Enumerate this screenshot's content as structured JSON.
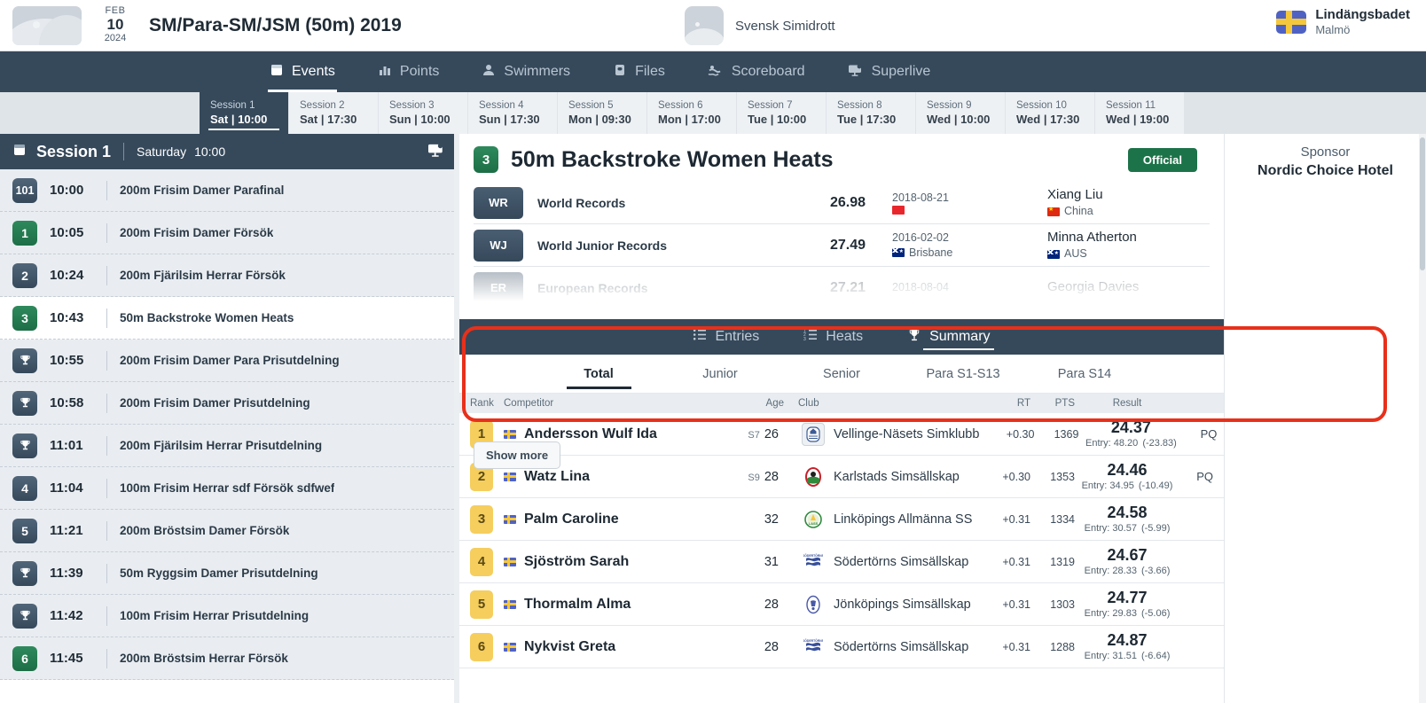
{
  "header": {
    "date": {
      "month": "FEB",
      "day": "10",
      "year": "2024"
    },
    "meet_title": "SM/Para-SM/JSM (50m) 2019",
    "organizer": "Svensk Simidrott",
    "venue_name": "Lindängsbadet",
    "venue_city": "Malmö",
    "meet_logo_icon": "image-placeholder-icon",
    "org_logo_icon": "image-placeholder-icon",
    "flag_icon": "sweden-flag-icon"
  },
  "nav": {
    "items": [
      {
        "label": "Events",
        "icon": "calendar-icon",
        "active": true
      },
      {
        "label": "Points",
        "icon": "bar-chart-icon",
        "active": false
      },
      {
        "label": "Swimmers",
        "icon": "person-icon",
        "active": false
      },
      {
        "label": "Files",
        "icon": "folder-icon",
        "active": false
      },
      {
        "label": "Scoreboard",
        "icon": "swimmer-icon",
        "active": false
      },
      {
        "label": "Superlive",
        "icon": "monitor-broadcast-icon",
        "active": false
      }
    ]
  },
  "sessions": [
    {
      "name": "Session 1",
      "time": "Sat | 10:00",
      "active": true
    },
    {
      "name": "Session 2",
      "time": "Sat | 17:30",
      "active": false
    },
    {
      "name": "Session 3",
      "time": "Sun | 10:00",
      "active": false
    },
    {
      "name": "Session 4",
      "time": "Sun | 17:30",
      "active": false
    },
    {
      "name": "Session 5",
      "time": "Mon | 09:30",
      "active": false
    },
    {
      "name": "Session 6",
      "time": "Mon | 17:00",
      "active": false
    },
    {
      "name": "Session 7",
      "time": "Tue | 10:00",
      "active": false
    },
    {
      "name": "Session 8",
      "time": "Tue | 17:30",
      "active": false
    },
    {
      "name": "Session 9",
      "time": "Wed | 10:00",
      "active": false
    },
    {
      "name": "Session 10",
      "time": "Wed | 17:30",
      "active": false
    },
    {
      "name": "Session 11",
      "time": "Wed | 19:00",
      "active": false
    }
  ],
  "sidebar": {
    "title": "Session 1",
    "day": "Saturday",
    "time": "10:00",
    "header_icon": "calendar-icon",
    "live_icon": "monitor-broadcast-icon",
    "events": [
      {
        "badge": "101",
        "badge_type": "slate",
        "time": "10:00",
        "name": "200m Frisim Damer Parafinal",
        "selected": false
      },
      {
        "badge": "1",
        "badge_type": "green",
        "time": "10:05",
        "name": "200m Frisim Damer Försök",
        "selected": false
      },
      {
        "badge": "2",
        "badge_type": "slate",
        "time": "10:24",
        "name": "200m Fjärilsim Herrar Försök",
        "selected": false
      },
      {
        "badge": "3",
        "badge_type": "green",
        "time": "10:43",
        "name": "50m Backstroke Women Heats",
        "selected": true
      },
      {
        "badge": "",
        "badge_type": "trophy",
        "time": "10:55",
        "name": "200m Frisim Damer Para Prisutdelning",
        "selected": false
      },
      {
        "badge": "",
        "badge_type": "trophy",
        "time": "10:58",
        "name": "200m Frisim Damer Prisutdelning",
        "selected": false
      },
      {
        "badge": "",
        "badge_type": "trophy",
        "time": "11:01",
        "name": "200m Fjärilsim Herrar Prisutdelning",
        "selected": false
      },
      {
        "badge": "4",
        "badge_type": "slate",
        "time": "11:04",
        "name": "100m Frisim Herrar sdf Försök sdfwef",
        "selected": false
      },
      {
        "badge": "5",
        "badge_type": "slate",
        "time": "11:21",
        "name": "200m Bröstsim Damer Försök",
        "selected": false
      },
      {
        "badge": "",
        "badge_type": "trophy",
        "time": "11:39",
        "name": "50m Ryggsim Damer Prisutdelning",
        "selected": false
      },
      {
        "badge": "",
        "badge_type": "trophy",
        "time": "11:42",
        "name": "100m Frisim Herrar Prisutdelning",
        "selected": false
      },
      {
        "badge": "6",
        "badge_type": "green",
        "time": "11:45",
        "name": "200m Bröstsim Herrar Försök",
        "selected": false
      }
    ]
  },
  "event": {
    "badge": "3",
    "title": "50m Backstroke Women Heats",
    "status": "Official"
  },
  "records": {
    "show_more_label": "Show more",
    "rows": [
      {
        "tag": "WR",
        "name": "World Records",
        "time": "26.98",
        "date": "2018-08-21",
        "place": "",
        "place_flag": "plain-red-flag-icon",
        "athlete": "Xiang Liu",
        "country": "China",
        "country_flag": "china-flag-icon",
        "faded": false
      },
      {
        "tag": "WJ",
        "name": "World Junior Records",
        "time": "27.49",
        "date": "2016-02-02",
        "place": "Brisbane",
        "place_flag": "australia-flag-icon",
        "athlete": "Minna Atherton",
        "country": "AUS",
        "country_flag": "australia-flag-icon",
        "faded": false
      },
      {
        "tag": "ER",
        "name": "European Records",
        "time": "27.21",
        "date": "2018-08-04",
        "place": "",
        "place_flag": "",
        "athlete": "Georgia Davies",
        "country": "",
        "country_flag": "",
        "faded": true
      }
    ]
  },
  "tabs": [
    {
      "label": "Entries",
      "icon": "list-ordered-icon",
      "active": false
    },
    {
      "label": "Heats",
      "icon": "list-numbered-icon",
      "active": false
    },
    {
      "label": "Summary",
      "icon": "trophy-icon",
      "active": true
    }
  ],
  "subtabs": [
    {
      "label": "Total",
      "active": true
    },
    {
      "label": "Junior",
      "active": false
    },
    {
      "label": "Senior",
      "active": false
    },
    {
      "label": "Para S1-S13",
      "active": false
    },
    {
      "label": "Para S14",
      "active": false
    }
  ],
  "results": {
    "columns": {
      "rank": "Rank",
      "competitor": "Competitor",
      "age": "Age",
      "club": "Club",
      "rt": "RT",
      "pts": "PTS",
      "result": "Result"
    },
    "rows": [
      {
        "rank": "1",
        "flag": "sweden-flag-icon",
        "name": "Andersson Wulf Ida",
        "para_class": "S7",
        "age": "26",
        "club": "Vellinge-Näsets Simklubb",
        "club_color": "#4a6ca8",
        "club_abbr": "VNS",
        "rt": "+0.30",
        "pts": "1369",
        "result": "24.37",
        "entry": "Entry: 48.20",
        "diff": "(-23.83)",
        "qual": "PQ"
      },
      {
        "rank": "2",
        "flag": "sweden-flag-icon",
        "name": "Watz Lina",
        "para_class": "S9",
        "age": "28",
        "club": "Karlstads Simsällskap",
        "club_color": "#c8202a",
        "club_abbr": "KS",
        "rt": "+0.30",
        "pts": "1353",
        "result": "24.46",
        "entry": "Entry: 34.95",
        "diff": "(-10.49)",
        "qual": "PQ"
      },
      {
        "rank": "3",
        "flag": "sweden-flag-icon",
        "name": "Palm Caroline",
        "para_class": "",
        "age": "32",
        "club": "Linköpings Allmänna SS",
        "club_color": "#2f8a3c",
        "club_abbr": "LASS",
        "rt": "+0.31",
        "pts": "1334",
        "result": "24.58",
        "entry": "Entry: 30.57",
        "diff": "(-5.99)",
        "qual": ""
      },
      {
        "rank": "4",
        "flag": "sweden-flag-icon",
        "name": "Sjöström Sarah",
        "para_class": "",
        "age": "31",
        "club": "Södertörns Simsällskap",
        "club_color": "#38509c",
        "club_abbr": "SÖS",
        "rt": "+0.31",
        "pts": "1319",
        "result": "24.67",
        "entry": "Entry: 28.33",
        "diff": "(-3.66)",
        "qual": ""
      },
      {
        "rank": "5",
        "flag": "sweden-flag-icon",
        "name": "Thormalm Alma",
        "para_class": "",
        "age": "28",
        "club": "Jönköpings Simsällskap",
        "club_color": "#4858a8",
        "club_abbr": "JS",
        "rt": "+0.31",
        "pts": "1303",
        "result": "24.77",
        "entry": "Entry: 29.83",
        "diff": "(-5.06)",
        "qual": ""
      },
      {
        "rank": "6",
        "flag": "sweden-flag-icon",
        "name": "Nykvist Greta",
        "para_class": "",
        "age": "28",
        "club": "Södertörns Simsällskap",
        "club_color": "#38509c",
        "club_abbr": "SÖS",
        "rt": "+0.31",
        "pts": "1288",
        "result": "24.87",
        "entry": "Entry: 31.51",
        "diff": "(-6.64)",
        "qual": ""
      }
    ]
  },
  "sponsor": {
    "label": "Sponsor",
    "name": "Nordic Choice Hotel"
  }
}
